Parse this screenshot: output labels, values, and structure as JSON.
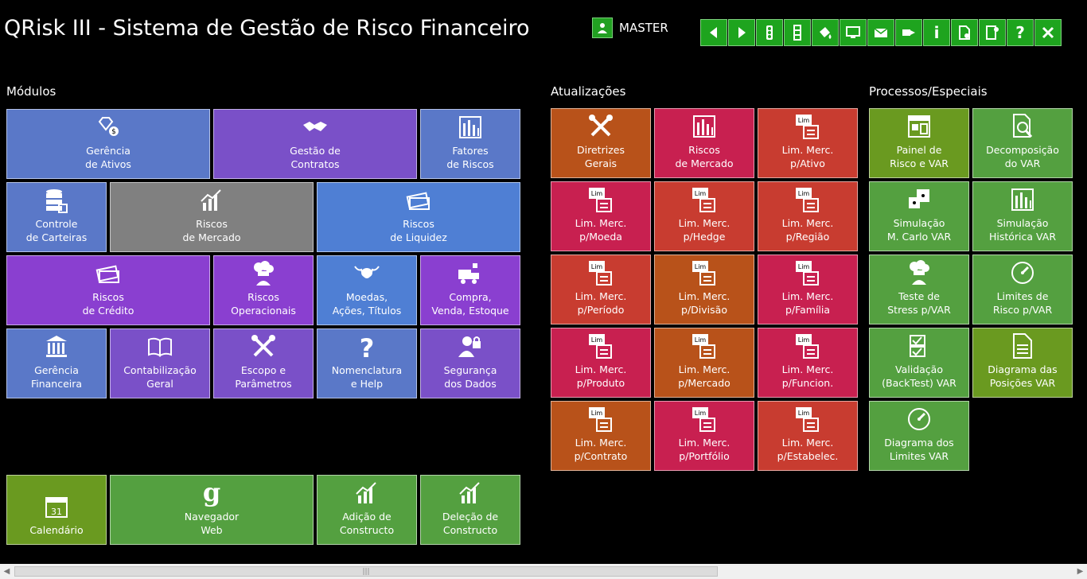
{
  "header": {
    "title": "QRisk III - Sistema de Gestão de Risco Financeiro",
    "user": "MASTER",
    "toolbar": [
      {
        "icon": "arrow-left-icon"
      },
      {
        "icon": "arrow-right-icon"
      },
      {
        "icon": "traffic-light-icon"
      },
      {
        "icon": "column-icon"
      },
      {
        "icon": "paint-bucket-icon"
      },
      {
        "icon": "monitor-icon"
      },
      {
        "icon": "mail-icon"
      },
      {
        "icon": "send-icon"
      },
      {
        "icon": "info-icon",
        "label": "i"
      },
      {
        "icon": "document-settings-icon"
      },
      {
        "icon": "exit-door-icon"
      },
      {
        "icon": "help-icon",
        "label": "?"
      },
      {
        "icon": "close-icon"
      }
    ]
  },
  "sections": {
    "modulos": "Módulos",
    "atualizacoes": "Atualizações",
    "processos": "Processos/Especiais"
  },
  "colors": {
    "blue": "#5a78c8",
    "purple": "#7a50c8",
    "gray": "#808080",
    "lightblue": "#4f7fd4",
    "violet": "#8a3fd0",
    "orange": "#b8521a",
    "crimson": "#c82050",
    "red": "#c83c30",
    "green": "#54a040",
    "olive": "#6a9a20",
    "toolbar": "#1ea41e"
  },
  "tiles": [
    {
      "label": "Gerência\nde Ativos",
      "icon": "diamonds-icon"
    },
    {
      "label": "Gestão de\nContratos",
      "icon": "handshake-icon"
    },
    {
      "label": "Fatores\nde  Riscos",
      "icon": "bar-chart-icon"
    },
    {
      "label": "Controle\nde Carteiras",
      "icon": "database-icon"
    },
    {
      "label": "Riscos\nde  Mercado",
      "icon": "trend-chart-icon"
    },
    {
      "label": "Riscos\nde Liquidez",
      "icon": "cash-icon"
    },
    {
      "label": "Riscos\nde  Crédito",
      "icon": "credit-card-icon"
    },
    {
      "label": "Riscos\nOperacionais",
      "icon": "chef-icon"
    },
    {
      "label": "Moedas,\nAções, Títulos",
      "icon": "bull-icon"
    },
    {
      "label": "Compra,\nVenda, Estoque",
      "icon": "truck-icon"
    },
    {
      "label": "Gerência\nFinanceira",
      "icon": "bank-icon"
    },
    {
      "label": "Contabilização\nGeral",
      "icon": "book-icon"
    },
    {
      "label": "Escopo e\nParâmetros",
      "icon": "tools-icon"
    },
    {
      "label": "Nomenclatura\ne Help",
      "icon": "question-icon"
    },
    {
      "label": "Segurança\ndos Dados",
      "icon": "user-lock-icon"
    },
    {
      "label": "Calendário",
      "icon": "calendar-icon"
    },
    {
      "label": "Navegador\nWeb",
      "icon": "google-icon"
    },
    {
      "label": "Adição de\nConstructo",
      "icon": "add-chart-icon"
    },
    {
      "label": "Deleção de\nConstructo",
      "icon": "delete-chart-icon"
    },
    {
      "label": "Diretrizes\nGerais",
      "icon": "tools-icon"
    },
    {
      "label": "Riscos\nde Mercado",
      "icon": "bar-chart-down-icon"
    },
    {
      "label": "Lim. Merc.\np/Ativo",
      "icon": "limit-dollar-icon"
    },
    {
      "label": "Lim. Merc.\np/Moeda",
      "icon": "limit-coin-icon"
    },
    {
      "label": "Lim. Merc.\np/Hedge",
      "icon": "limit-chair-icon"
    },
    {
      "label": "Lim. Merc.\np/Região",
      "icon": "limit-globe-icon"
    },
    {
      "label": "Lim. Merc.\np/Período",
      "icon": "limit-calendar-icon"
    },
    {
      "label": "Lim. Merc.\np/Divisão",
      "icon": "limit-people-icon"
    },
    {
      "label": "Lim. Merc.\np/Família",
      "icon": "limit-list-icon"
    },
    {
      "label": "Lim. Merc.\np/Produto",
      "icon": "limit-factory-icon"
    },
    {
      "label": "Lim. Merc.\np/Mercado",
      "icon": "limit-market-icon"
    },
    {
      "label": "Lim. Merc.\np/Funcion.",
      "icon": "limit-person-icon"
    },
    {
      "label": "Lim. Merc.\np/Contrato",
      "icon": "limit-contract-icon"
    },
    {
      "label": "Lim. Merc.\np/Portfólio",
      "icon": "limit-briefcase-icon"
    },
    {
      "label": "Lim. Merc.\np/Estabelec.",
      "icon": "limit-building-icon"
    },
    {
      "label": "Painel de\nRisco e VAR",
      "icon": "panel-icon"
    },
    {
      "label": "Decomposição\ndo VAR",
      "icon": "search-doc-icon"
    },
    {
      "label": "Simulação\nM. Carlo VAR",
      "icon": "dice-icon"
    },
    {
      "label": "Simulação\nHistórica VAR",
      "icon": "history-icon"
    },
    {
      "label": "Teste de\nStress p/VAR",
      "icon": "chef-icon"
    },
    {
      "label": "Limites de\nRisco p/VAR",
      "icon": "gauge-icon"
    },
    {
      "label": "Validação\n(BackTest) VAR",
      "icon": "checklist-icon"
    },
    {
      "label": "Diagrama das\nPosições VAR",
      "icon": "document-icon"
    },
    {
      "label": "Diagrama dos\nLimites VAR",
      "icon": "dial-gear-icon"
    }
  ]
}
